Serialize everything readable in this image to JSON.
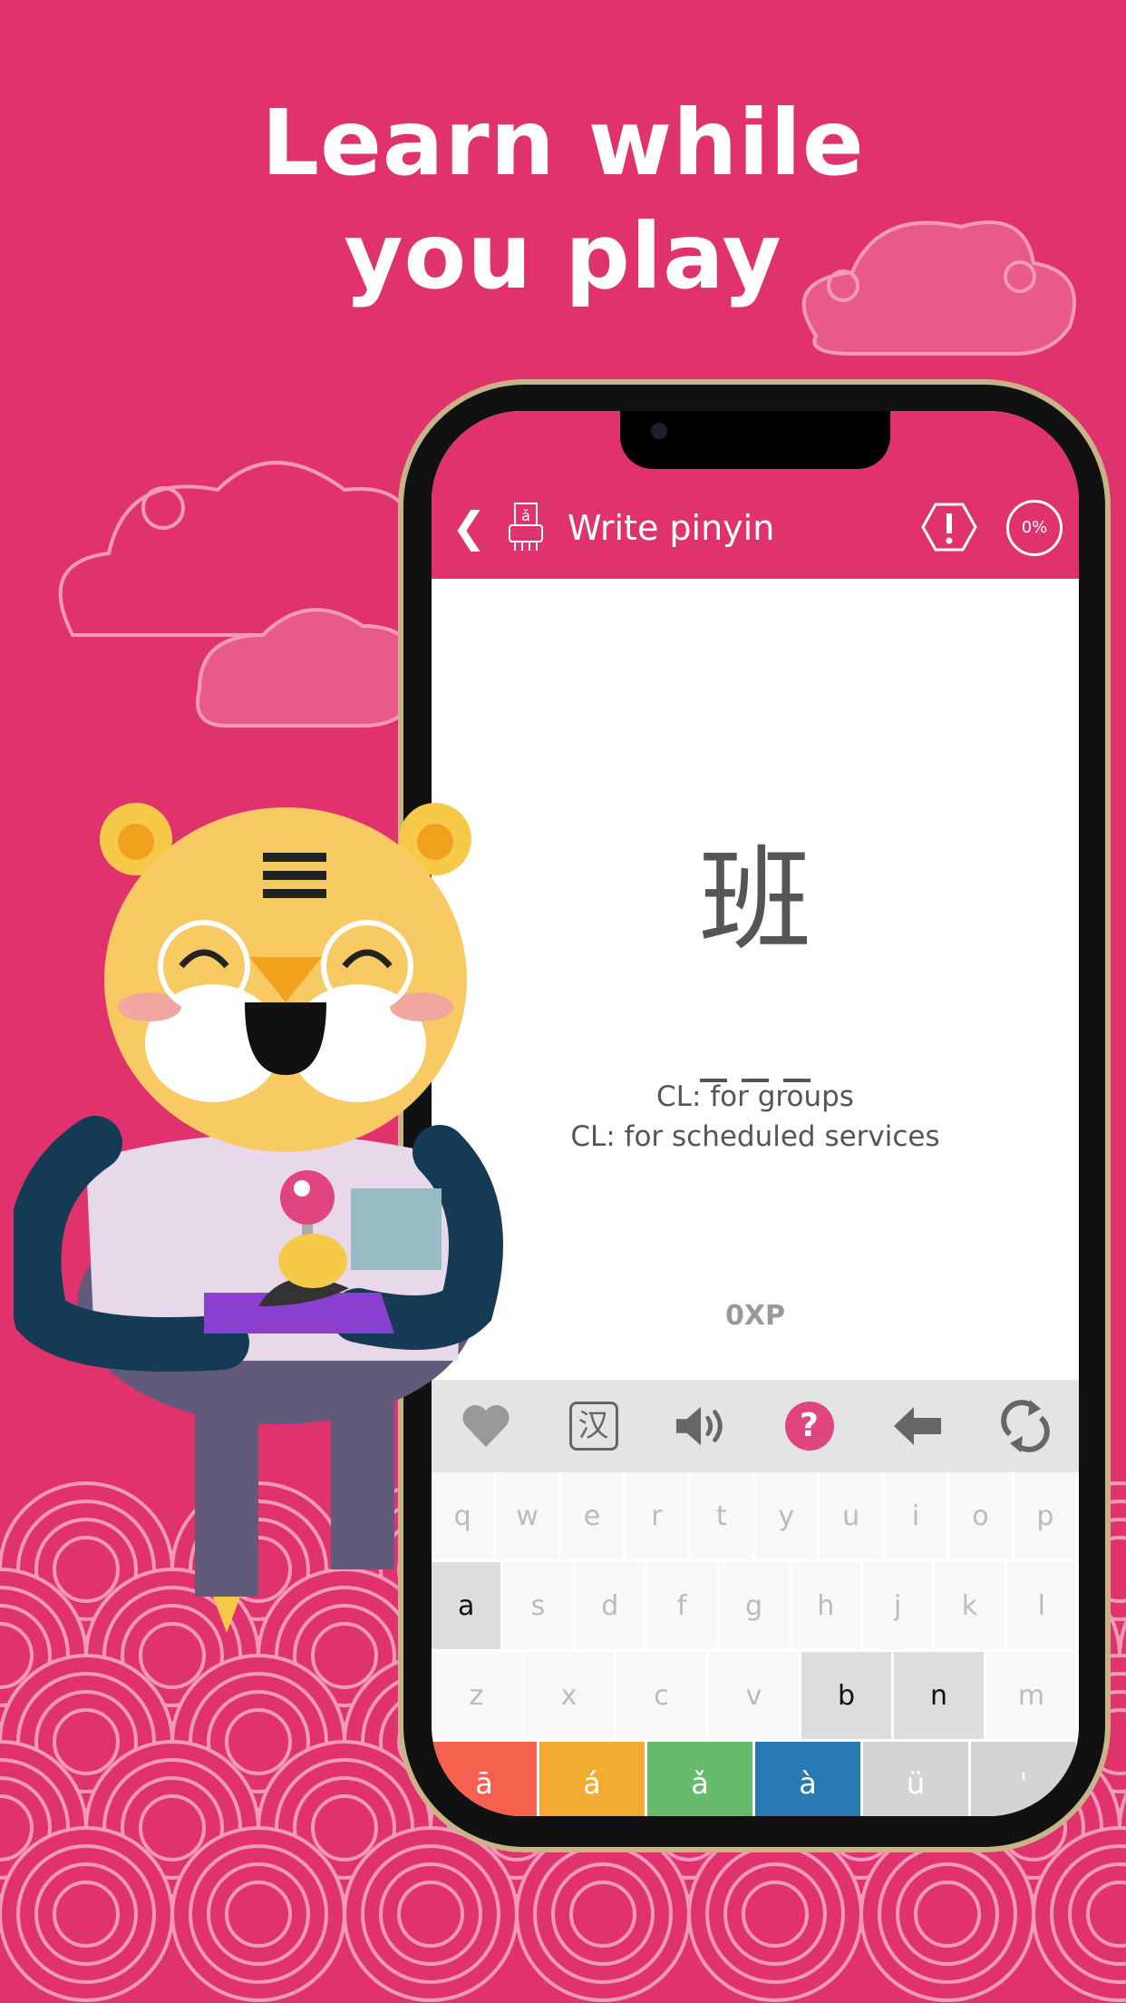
{
  "headline": {
    "line1": "Learn while",
    "line2": "you play"
  },
  "header": {
    "back_icon": "chevron-left-icon",
    "mode_icon": "typewriter-icon",
    "title": "Write pinyin",
    "report_icon": "exclamation-hexagon-icon",
    "progress": "0%"
  },
  "question": {
    "hanzi": "班",
    "meanings": [
      "CL: for groups",
      "CL: for scheduled services"
    ],
    "xp": "0XP",
    "answer_slots": 3
  },
  "toolbar": {
    "icons": [
      "heart-icon",
      "hanzi-icon",
      "speaker-icon",
      "help-icon",
      "backspace-icon",
      "refresh-icon"
    ],
    "hanzi_label": "汉"
  },
  "keyboard": {
    "row1": [
      "q",
      "w",
      "e",
      "r",
      "t",
      "y",
      "u",
      "i",
      "o",
      "p"
    ],
    "row2": [
      "a",
      "s",
      "d",
      "f",
      "g",
      "h",
      "j",
      "k",
      "l"
    ],
    "row3": [
      "z",
      "x",
      "c",
      "v",
      "b",
      "n",
      "m"
    ],
    "active": [
      "a",
      "b",
      "n"
    ],
    "tones": [
      {
        "label": "ā",
        "color": "#f5604f"
      },
      {
        "label": "á",
        "color": "#f4ab33"
      },
      {
        "label": "ǎ",
        "color": "#66bb6a"
      },
      {
        "label": "à",
        "color": "#2979b3"
      },
      {
        "label": "ü",
        "color": "#d4d4d4"
      },
      {
        "label": "'",
        "color": "#d4d4d4"
      }
    ]
  },
  "colors": {
    "brand": "#e0336e",
    "help": "#e0457f"
  }
}
